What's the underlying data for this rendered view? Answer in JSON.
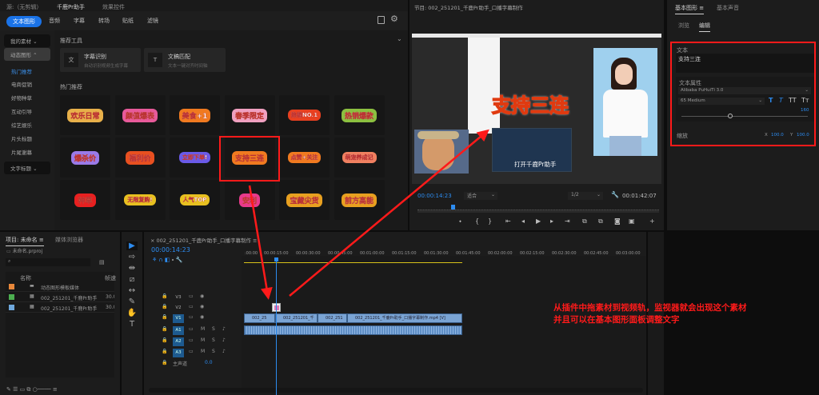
{
  "left_panel": {
    "tabs": [
      "源:（无剪辑）",
      "千鹿Pr助手",
      "效果控件"
    ],
    "categories": [
      "文本图形",
      "音频",
      "字幕",
      "转场",
      "贴纸",
      "滤镜"
    ],
    "sidebar": [
      "我的素材",
      "动态图形",
      "热门推荐",
      "电商促销",
      "好物种草",
      "互动引导",
      "综艺娱乐",
      "片头标题",
      "片尾谢幕",
      "文字标题"
    ],
    "tools_title": "推荐工具",
    "tools": [
      {
        "name": "字幕识别",
        "desc": "自动识别视频生成字幕"
      },
      {
        "name": "文稿匹配",
        "desc": "文本一键对齐时间轴"
      }
    ],
    "hot_title": "热门推荐",
    "stickers": [
      "欢乐日常",
      "颜值爆表",
      "美食+1",
      "春季限定",
      "热销NO.1",
      "热销爆款",
      "爆杀价",
      "福利价",
      "立即下单!",
      "支持三连",
      "点赞+关注",
      "萌宠养成记",
      "种草",
      "无限复购!",
      "人气TOP",
      "安利",
      "宝藏尖货",
      "前方高能"
    ]
  },
  "monitor": {
    "title": "节目: 002_251201_千鹿Pr助手_口播字幕制作",
    "overlay_text": "支持三连",
    "caption": "打开千鹿Pr助手",
    "timecode": "00:00:14:23",
    "fit": "适合",
    "resolution": "1/2",
    "duration": "00:01:42:07",
    "playhead_fraction": 0.14
  },
  "right_panel": {
    "tabs": [
      "基本图形",
      "基本声音"
    ],
    "subtabs": [
      "浏览",
      "编辑"
    ],
    "text_label": "文本",
    "text_value": "支持三连",
    "props_label": "文本属性",
    "font": "Alibaba PuHuiTi 3.0",
    "weight": "65 Medium",
    "size": "160",
    "scale_label": "缩放",
    "x_label": "X",
    "x_value": "100.0",
    "y_label": "Y",
    "y_value": "100.0"
  },
  "project": {
    "tabs": [
      "项目: 未命名",
      "媒体浏览器"
    ],
    "file": "未命名.prproj",
    "col_name": "名称",
    "col_rate": "帧速",
    "items": [
      {
        "name": "动态图形模板媒体",
        "color": "#e8873a",
        "rate": ""
      },
      {
        "name": "002_251201_千鹿Pr助手",
        "color": "#4caf50",
        "rate": "30.0"
      },
      {
        "name": "002_251201_千鹿Pr助手",
        "color": "#6fa8dc",
        "rate": "30.0"
      }
    ]
  },
  "timeline": {
    "title": "002_251201_千鹿Pr助手_口播字幕制作",
    "timecode": "00:00:14:23",
    "ruler": [
      ":00:00",
      "00:00:15:00",
      "00:00:30:00",
      "00:00:45:00",
      "00:01:00:00",
      "00:01:15:00",
      "00:01:30:00",
      "00:01:45:00",
      "00:02:00:00",
      "00:02:15:00",
      "00:02:30:00",
      "00:02:45:00",
      "00:03:00:00"
    ],
    "tracks": [
      "V3",
      "V2",
      "V1",
      "A1",
      "A2",
      "A3"
    ],
    "master": "主声道",
    "master_val": "0.0",
    "clips": [
      "002_25",
      "002_251201_千",
      "002_251",
      "002_251201_千鹿Pr助手_口播字幕制作.mp4 [V]"
    ]
  },
  "annotation": {
    "line1": "从插件中拖素材到视频轨，监视器就会出现这个素材",
    "line2": "并且可以在基本图形面板调整文字",
    "color": "#ff1a1a"
  }
}
